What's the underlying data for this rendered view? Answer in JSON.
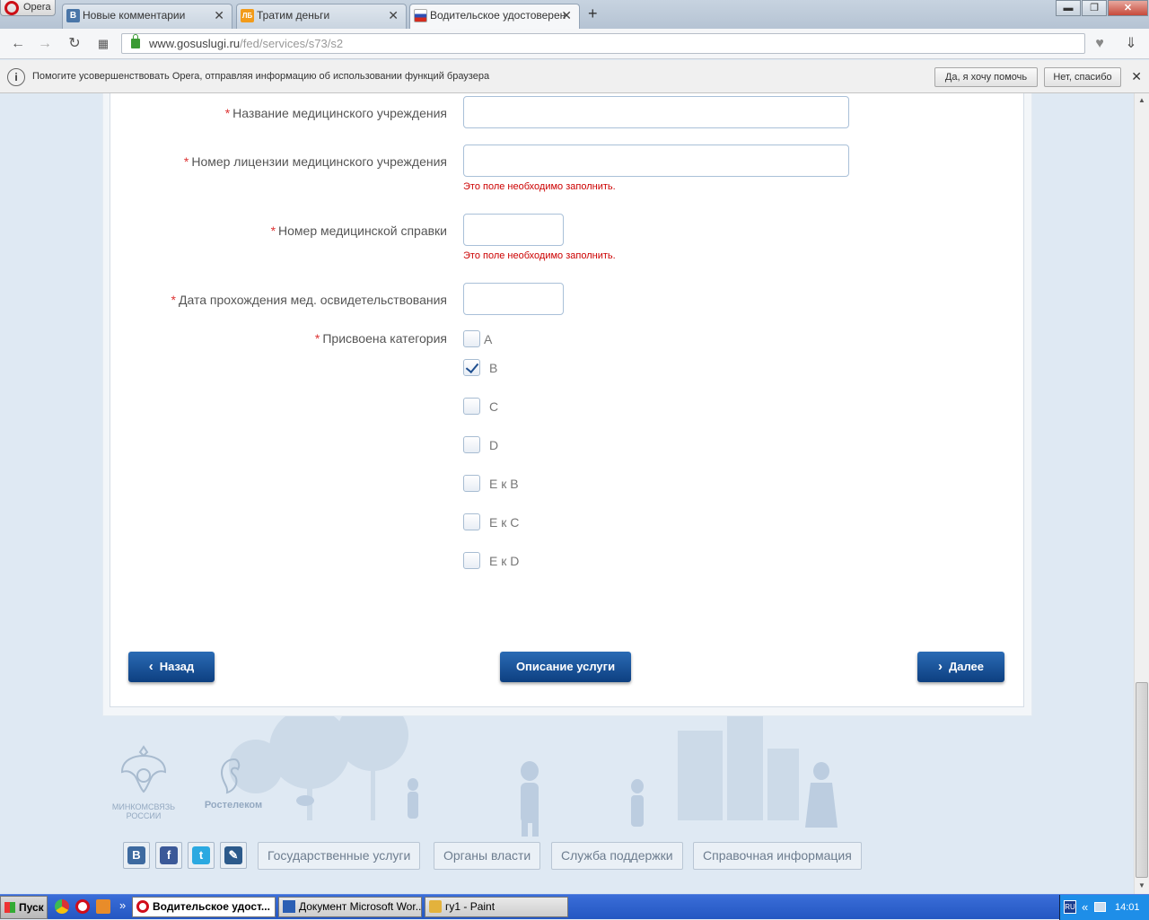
{
  "browser": {
    "opera_label": "Opera",
    "tabs": [
      {
        "label": "Новые комментарии",
        "icon": "vk-icon",
        "icon_text": "B",
        "color": "#4a76a8"
      },
      {
        "label": "Тратим деньги",
        "icon": "lj-icon",
        "icon_text": "ЛБ",
        "color": "#f29b1a"
      },
      {
        "label": "Водительское удостоверен",
        "icon": "russia-flag-icon",
        "icon_text": "",
        "color": "#ffffff"
      }
    ],
    "url_host": "www.gosuslugi.ru",
    "url_path": "/fed/services/s73/s2",
    "new_tab": "+",
    "tab_close": "✕",
    "win_min": "▬",
    "win_max": "❐",
    "win_close": "✕"
  },
  "infobar": {
    "text": "Помогите усовершенствовать Opera, отправляя информацию об использовании функций браузера",
    "yes": "Да, я хочу помочь",
    "no": "Нет, спасибо",
    "close": "✕"
  },
  "form": {
    "required_mark": "*",
    "fields": [
      {
        "label": "Название медицинского учреждения",
        "value": ""
      },
      {
        "label": "Номер лицензии медицинского учреждения",
        "value": "",
        "error": "Это поле необходимо заполнить."
      },
      {
        "label": "Номер медицинской справки",
        "value": "",
        "error": "Это поле необходимо заполнить."
      },
      {
        "label": "Дата прохождения мед. освидетельствования",
        "value": ""
      }
    ],
    "category_label": "Присвоена категория",
    "categories": [
      {
        "label": "A",
        "checked": false
      },
      {
        "label": "B",
        "checked": true
      },
      {
        "label": "C",
        "checked": false
      },
      {
        "label": "D",
        "checked": false
      },
      {
        "label": "E к B",
        "checked": false
      },
      {
        "label": "E к C",
        "checked": false
      },
      {
        "label": "E к D",
        "checked": false
      }
    ],
    "back": "Назад",
    "describe": "Описание услуги",
    "next": "Далее"
  },
  "footer": {
    "logo1": "МИНКОМСВЯЗЬ РОССИИ",
    "logo2": "Ростелеком",
    "social": [
      {
        "name": "vk",
        "text": "B",
        "color": "#3d6aa0"
      },
      {
        "name": "facebook",
        "text": "f",
        "color": "#3b5998"
      },
      {
        "name": "twitter",
        "text": "t",
        "color": "#2ba9e1"
      },
      {
        "name": "livejournal",
        "text": "✎",
        "color": "#2c5a8b"
      }
    ],
    "links": [
      "Государственные услуги",
      "Органы власти",
      "Служба поддержки",
      "Справочная информация"
    ]
  },
  "taskbar": {
    "start": "Пуск",
    "chevron": "»",
    "tasks": [
      "Водительское удост...",
      "Документ Microsoft Wor...",
      "гу1 - Paint"
    ],
    "lang": "RU",
    "tray_chevron": "«",
    "time": "14:01"
  }
}
